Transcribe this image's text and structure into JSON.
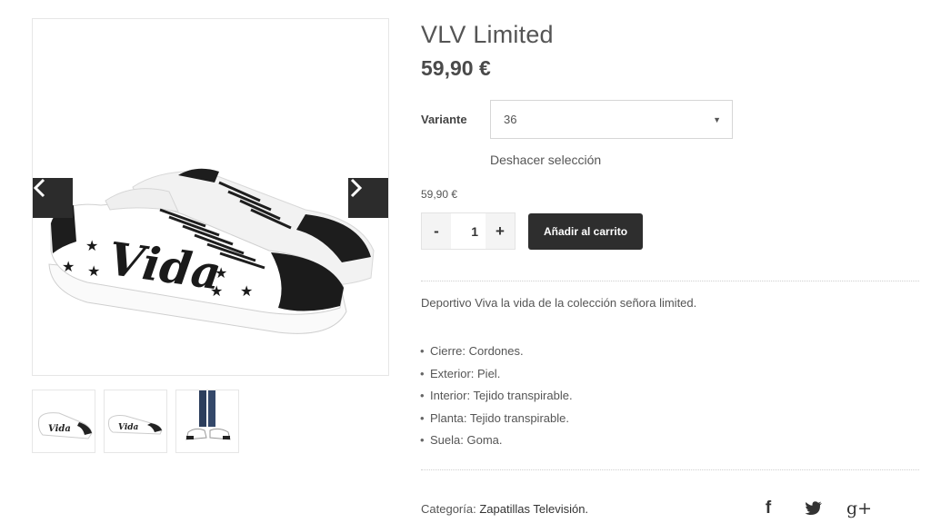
{
  "gallery": {
    "main_image_alt": "Vida",
    "thumbnails": [
      {
        "name": "thumb-1",
        "alt": "Vida"
      },
      {
        "name": "thumb-2",
        "alt": "Vida"
      },
      {
        "name": "thumb-3",
        "alt": ""
      }
    ],
    "prev_icon": "chevron-left-icon",
    "next_icon": "chevron-right-icon"
  },
  "product": {
    "title": "VLV Limited",
    "price": "59,90 €"
  },
  "variant": {
    "label": "Variante",
    "selected": "36",
    "reset_label": "Deshacer selección"
  },
  "variation_price": "59,90 €",
  "cart": {
    "minus": "-",
    "quantity": "1",
    "plus": "+",
    "add_label": "Añadir al carrito"
  },
  "description": "Deportivo Viva la vida de la colección señora limited.",
  "features": [
    "Cierre: Cordones.",
    "Exterior: Piel.",
    "Interior: Tejido transpirable.",
    "Planta: Tejido transpirable.",
    "Suela: Goma."
  ],
  "meta": {
    "category_label": "Categoría:",
    "category_link": "Zapatillas Televisión."
  },
  "share": {
    "icons": [
      "facebook-icon",
      "twitter-icon",
      "google-plus-icon"
    ],
    "facebook_glyph": "f",
    "google_glyph": "g+"
  },
  "colors": {
    "accent_dark": "#2e2e2e",
    "text": "#555555"
  }
}
